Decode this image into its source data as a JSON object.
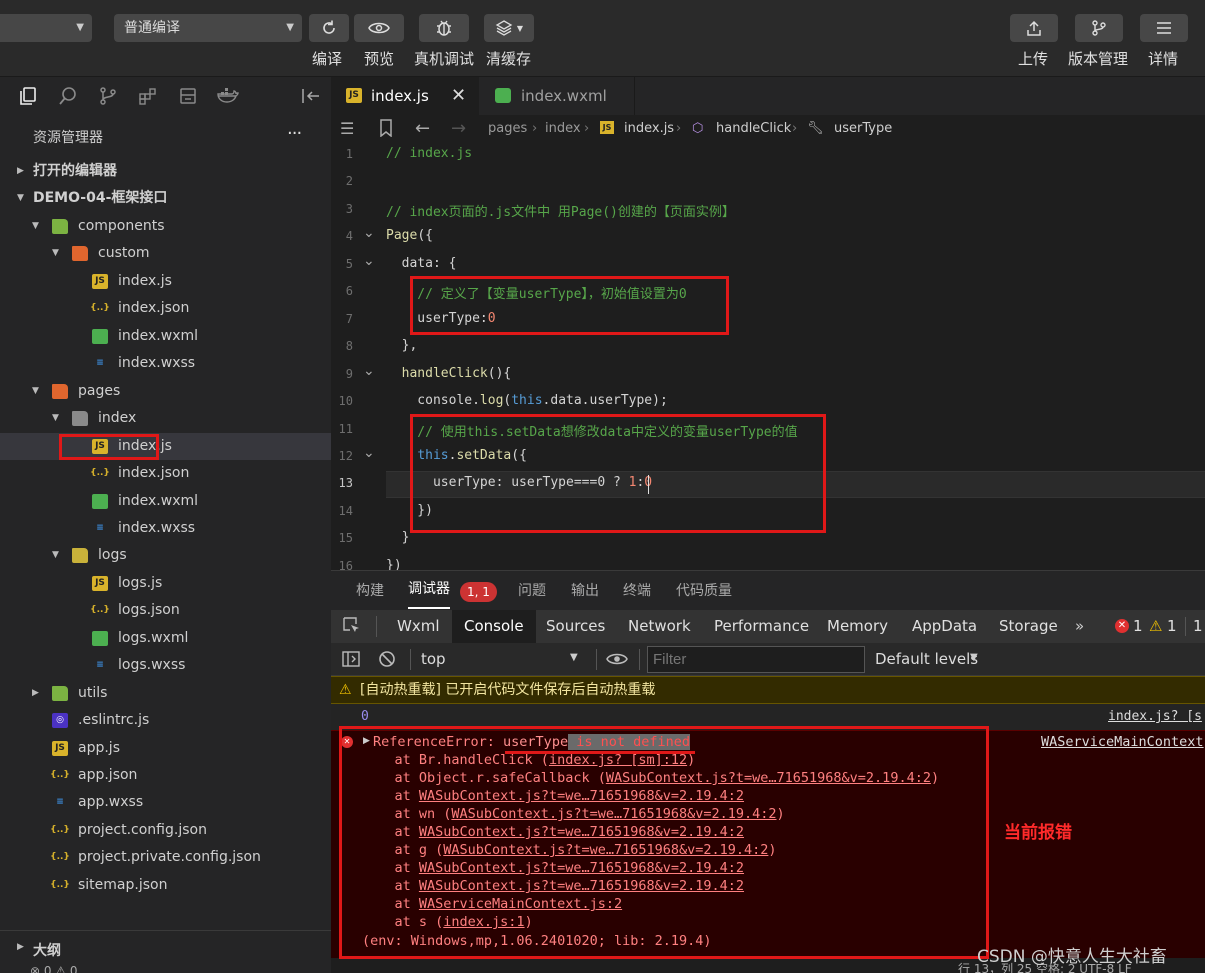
{
  "toolbar": {
    "mode_select": "普通编译",
    "buttons": [
      "编译",
      "预览",
      "真机调试",
      "清缓存"
    ],
    "right_buttons": [
      "上传",
      "版本管理",
      "详情"
    ]
  },
  "sidebar": {
    "title": "资源管理器",
    "more": "···",
    "open_editors": "打开的编辑器",
    "project": "DEMO-04-框架接口",
    "tree": [
      {
        "name": "components",
        "type": "folder",
        "depth": 1
      },
      {
        "name": "custom",
        "type": "folder",
        "depth": 2
      },
      {
        "name": "index.js",
        "type": "js",
        "depth": 3
      },
      {
        "name": "index.json",
        "type": "json",
        "depth": 3
      },
      {
        "name": "index.wxml",
        "type": "wxml",
        "depth": 3
      },
      {
        "name": "index.wxss",
        "type": "wxss",
        "depth": 3
      },
      {
        "name": "pages",
        "type": "folder",
        "depth": 1
      },
      {
        "name": "index",
        "type": "folder",
        "depth": 2
      },
      {
        "name": "index.js",
        "type": "js",
        "depth": 3
      },
      {
        "name": "index.json",
        "type": "json",
        "depth": 3
      },
      {
        "name": "index.wxml",
        "type": "wxml",
        "depth": 3
      },
      {
        "name": "index.wxss",
        "type": "wxss",
        "depth": 3
      },
      {
        "name": "logs",
        "type": "folder",
        "depth": 2
      },
      {
        "name": "logs.js",
        "type": "js",
        "depth": 3
      },
      {
        "name": "logs.json",
        "type": "json",
        "depth": 3
      },
      {
        "name": "logs.wxml",
        "type": "wxml",
        "depth": 3
      },
      {
        "name": "logs.wxss",
        "type": "wxss",
        "depth": 3
      },
      {
        "name": "utils",
        "type": "folder",
        "depth": 1
      },
      {
        "name": ".eslintrc.js",
        "type": "eslint",
        "depth": 1
      },
      {
        "name": "app.js",
        "type": "js",
        "depth": 1
      },
      {
        "name": "app.json",
        "type": "json",
        "depth": 1
      },
      {
        "name": "app.wxss",
        "type": "wxss",
        "depth": 1
      },
      {
        "name": "project.config.json",
        "type": "json",
        "depth": 1
      },
      {
        "name": "project.private.config.json",
        "type": "json",
        "depth": 1
      },
      {
        "name": "sitemap.json",
        "type": "json",
        "depth": 1
      }
    ],
    "outline": "大纲",
    "status": "⊗ 0 ⚠ 0"
  },
  "editor": {
    "tabs": [
      "index.js",
      "index.wxml"
    ],
    "breadcrumb": [
      "pages",
      "index",
      "index.js",
      "handleClick",
      "userType"
    ],
    "lines": [
      {
        "n": "1",
        "text": "// index.js"
      },
      {
        "n": "2",
        "text": ""
      },
      {
        "n": "3",
        "text": "// index页面的.js文件中 用Page()创建的【页面实例】"
      },
      {
        "n": "4",
        "text": "Page({"
      },
      {
        "n": "5",
        "text": "  data: {"
      },
      {
        "n": "6",
        "text": "    // 定义了【变量userType】，初始值设置为0"
      },
      {
        "n": "7",
        "text": "    userType:0"
      },
      {
        "n": "8",
        "text": "  },"
      },
      {
        "n": "9",
        "text": "  handleClick(){"
      },
      {
        "n": "10",
        "text": "    console.log(this.data.userType);"
      },
      {
        "n": "11",
        "text": "    // 使用this.setData想修改data中定义的变量userType的值"
      },
      {
        "n": "12",
        "text": "    this.setData({"
      },
      {
        "n": "13",
        "text": "      userType: userType===0 ? 1:0"
      },
      {
        "n": "14",
        "text": "    })"
      },
      {
        "n": "15",
        "text": "  }"
      },
      {
        "n": "16",
        "text": "})"
      }
    ]
  },
  "panel": {
    "tabs": [
      "构建",
      "调试器",
      "问题",
      "输出",
      "终端",
      "代码质量"
    ],
    "debugger_badge": "1, 1",
    "devtools_tabs": [
      "Wxml",
      "Console",
      "Sources",
      "Network",
      "Performance",
      "Memory",
      "AppData",
      "Storage"
    ],
    "more": "»",
    "error_count": "1",
    "warning_count": "1",
    "extra_count": "1",
    "context": "top",
    "filter_placeholder": "Filter",
    "levels": "Default levels",
    "warning_message": "[自动热重载] 已开启代码文件保存后自动热重载",
    "log_value": "0",
    "log_source": "index.js? [s",
    "error_source": "WAServiceMainContext",
    "error_head": "ReferenceError: ",
    "error_var": "userType",
    "error_tail": " is not defined",
    "stack": [
      {
        "pre": "    at Br.handleClick (",
        "link": "index.js? [sm]:12",
        "post": ")"
      },
      {
        "pre": "    at Object.r.safeCallback (",
        "link": "WASubContext.js?t=we…71651968&v=2.19.4:2",
        "post": ")"
      },
      {
        "pre": "    at ",
        "link": "WASubContext.js?t=we…71651968&v=2.19.4:2",
        "post": ""
      },
      {
        "pre": "    at wn (",
        "link": "WASubContext.js?t=we…71651968&v=2.19.4:2",
        "post": ")"
      },
      {
        "pre": "    at ",
        "link": "WASubContext.js?t=we…71651968&v=2.19.4:2",
        "post": ""
      },
      {
        "pre": "    at g (",
        "link": "WASubContext.js?t=we…71651968&v=2.19.4:2",
        "post": ")"
      },
      {
        "pre": "    at ",
        "link": "WASubContext.js?t=we…71651968&v=2.19.4:2",
        "post": ""
      },
      {
        "pre": "    at ",
        "link": "WASubContext.js?t=we…71651968&v=2.19.4:2",
        "post": ""
      },
      {
        "pre": "    at ",
        "link": "WAServiceMainContext.js:2",
        "post": ""
      },
      {
        "pre": "    at s (",
        "link": "index.js:1",
        "post": ")"
      }
    ],
    "env": "(env: Windows,mp,1.06.2401020; lib: 2.19.4)",
    "annotation": "当前报错"
  },
  "statusbar": "行 13，列 25    空格: 2    UTF-8    LF",
  "watermark": "CSDN @快意人生大社畜",
  "colors": {
    "highlight_box": "#e01818",
    "annotation": "#ff2a2a",
    "error_bg": "#290000"
  }
}
